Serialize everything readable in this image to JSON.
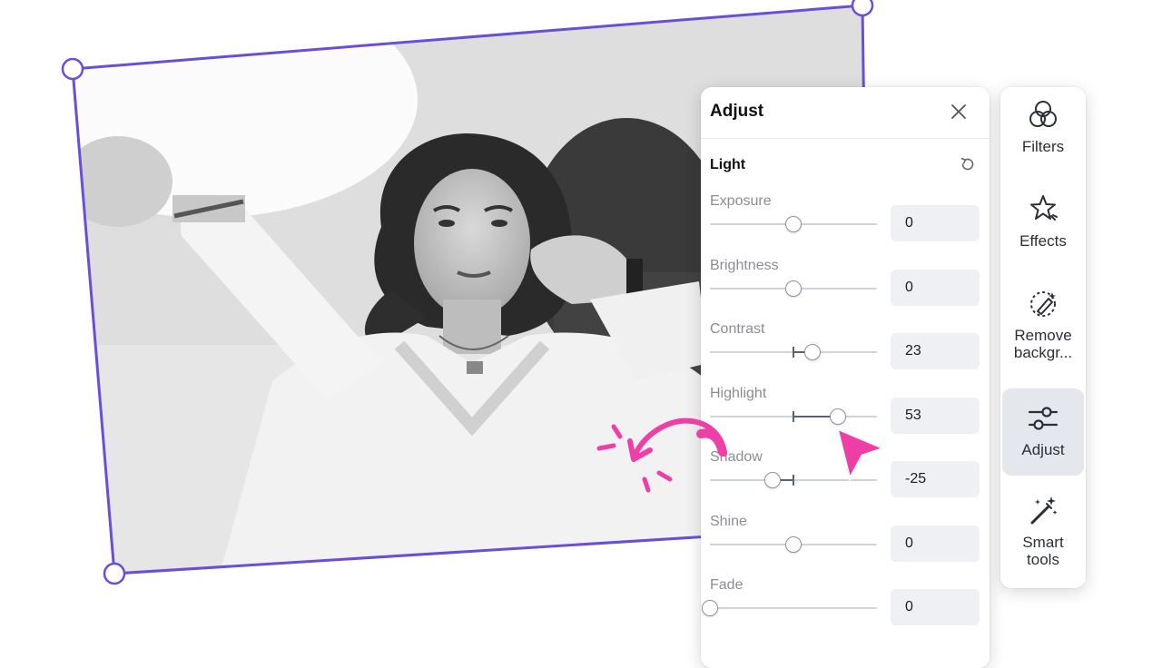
{
  "panel": {
    "title": "Adjust",
    "section": "Light",
    "adjustments": [
      {
        "label": "Exposure",
        "value": "0",
        "num": 0
      },
      {
        "label": "Brightness",
        "value": "0",
        "num": 0
      },
      {
        "label": "Contrast",
        "value": "23",
        "num": 23
      },
      {
        "label": "Highlight",
        "value": "53",
        "num": 53
      },
      {
        "label": "Shadow",
        "value": "-25",
        "num": -25
      },
      {
        "label": "Shine",
        "value": "0",
        "num": 0
      },
      {
        "label": "Fade",
        "value": "0",
        "num": 0
      }
    ]
  },
  "toolbar": {
    "items": [
      {
        "label": "Filters",
        "icon": "filters-icon"
      },
      {
        "label": "Effects",
        "icon": "effects-icon"
      },
      {
        "label": "Remove backgr...",
        "icon": "remove-background-icon"
      },
      {
        "label": "Adjust",
        "icon": "adjust-icon",
        "active": true
      },
      {
        "label": "Smart tools",
        "icon": "magic-wand-icon"
      }
    ]
  },
  "colors": {
    "selection": "#6a4fd6",
    "annotation": "#ee3fa6",
    "active_tool_bg": "#e4e7eb"
  }
}
